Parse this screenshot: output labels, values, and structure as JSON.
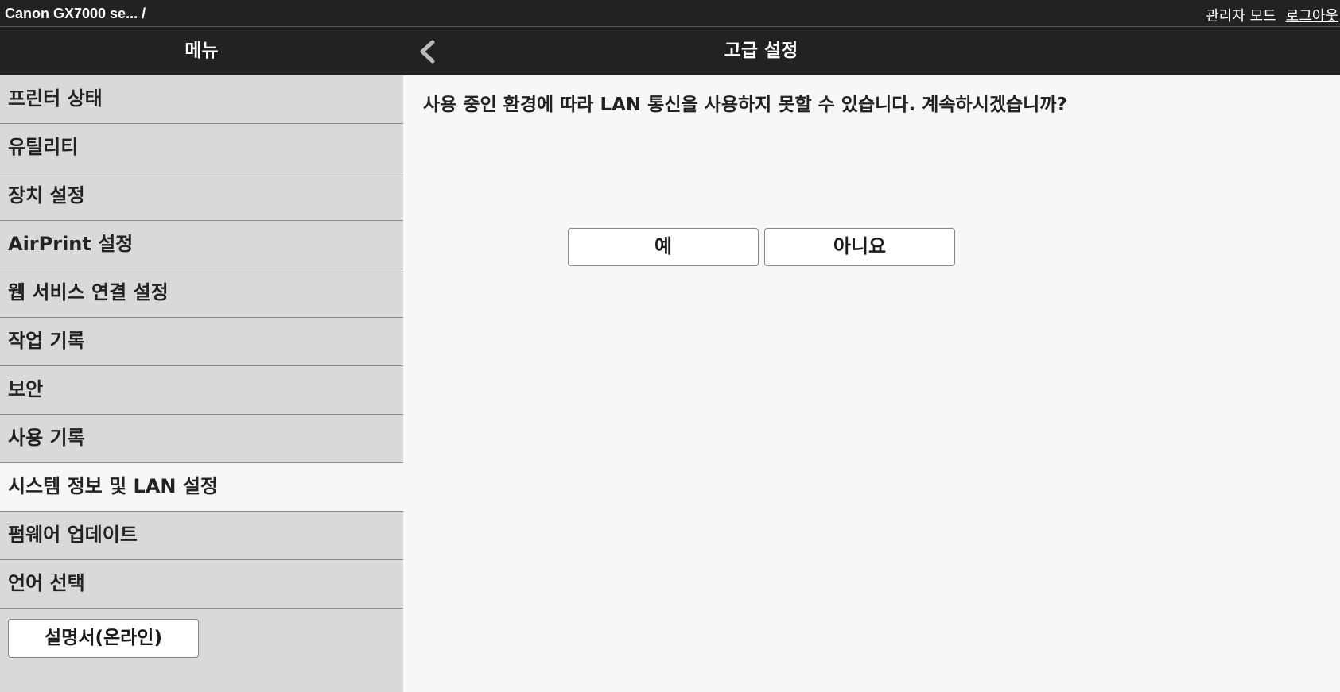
{
  "topbar": {
    "breadcrumb": "Canon GX7000 se... /",
    "admin_mode": "관리자 모드",
    "logout": "로그아웃"
  },
  "header": {
    "menu_title": "메뉴",
    "page_title": "고급 설정",
    "back_icon": "chevron-left-icon"
  },
  "sidebar": {
    "items": [
      {
        "label": "프린터 상태"
      },
      {
        "label": "유틸리티"
      },
      {
        "label": "장치 설정"
      },
      {
        "label": "AirPrint 설정"
      },
      {
        "label": "웹 서비스 연결 설정"
      },
      {
        "label": "작업 기록"
      },
      {
        "label": "보안"
      },
      {
        "label": "사용 기록"
      },
      {
        "label": "시스템 정보 및 LAN 설정",
        "active": true
      },
      {
        "label": "펌웨어 업데이트"
      },
      {
        "label": "언어 선택"
      }
    ],
    "manual_button": "설명서(온라인)"
  },
  "main": {
    "message": "사용 중인 환경에 따라 LAN 통신을 사용하지 못할 수 있습니다. 계속하시겠습니까?",
    "yes_label": "예",
    "no_label": "아니요"
  },
  "colors": {
    "header_bg": "#222222",
    "sidebar_bg": "#d9d9d9",
    "active_bg": "#f7f7f7",
    "content_bg": "#f7f7f7"
  }
}
